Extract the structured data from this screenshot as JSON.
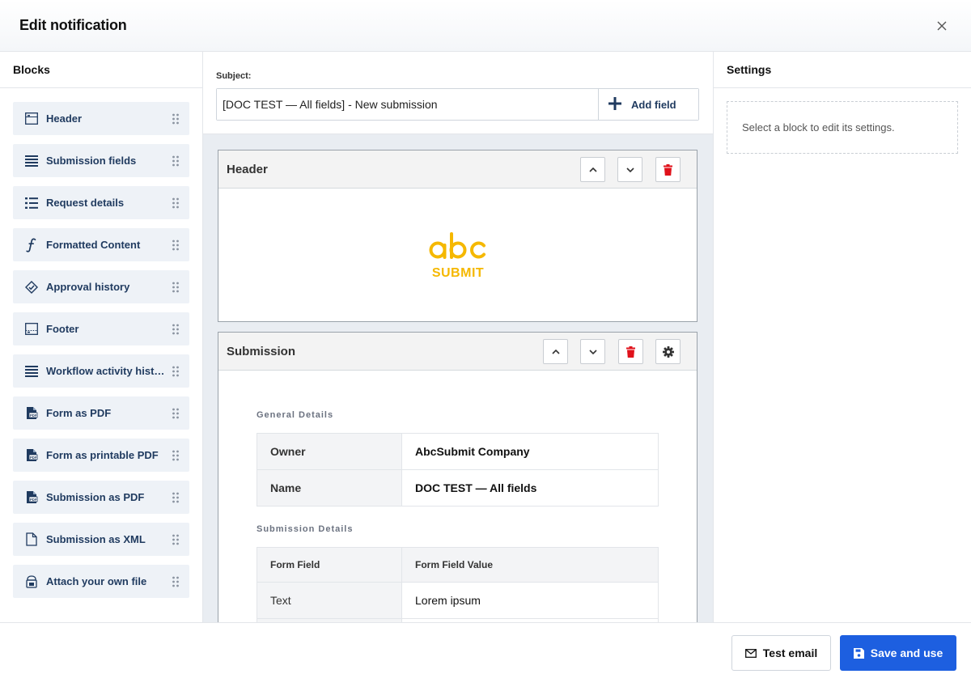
{
  "dialog": {
    "title": "Edit notification",
    "close_icon": "close-icon"
  },
  "blocks_panel": {
    "title": "Blocks",
    "items": [
      {
        "label": "Header",
        "icon": "header-icon"
      },
      {
        "label": "Submission fields",
        "icon": "list-lines-icon"
      },
      {
        "label": "Request details",
        "icon": "bullet-list-icon"
      },
      {
        "label": "Formatted Content",
        "icon": "function-icon"
      },
      {
        "label": "Approval history",
        "icon": "approval-icon"
      },
      {
        "label": "Footer",
        "icon": "footer-icon"
      },
      {
        "label": "Workflow activity history",
        "icon": "list-lines-icon"
      },
      {
        "label": "Form as PDF",
        "icon": "pdf-icon"
      },
      {
        "label": "Form as printable PDF",
        "icon": "pdf-icon"
      },
      {
        "label": "Submission as PDF",
        "icon": "pdf-icon"
      },
      {
        "label": "Submission as XML",
        "icon": "file-icon"
      },
      {
        "label": "Attach your own file",
        "icon": "attach-file-icon"
      }
    ]
  },
  "subject": {
    "label": "Subject:",
    "value": "[DOC TEST — All fields] - New submission",
    "add_field_label": "Add field"
  },
  "header_block": {
    "title": "Header",
    "logo_text_top": "abc",
    "logo_text_bottom": "SUBMIT",
    "brand_color": "#F5B800"
  },
  "submission_block": {
    "title": "Submission",
    "general_title": "General Details",
    "general_rows": [
      {
        "key": "Owner",
        "value": "AbcSubmit Company"
      },
      {
        "key": "Name",
        "value": "DOC TEST — All fields"
      }
    ],
    "details_title": "Submission Details",
    "fields_header": {
      "key": "Form Field",
      "value": "Form Field Value"
    },
    "field_rows": [
      {
        "key": "Text",
        "value": "Lorem ipsum"
      },
      {
        "key": "",
        "value": ""
      }
    ]
  },
  "settings_panel": {
    "title": "Settings",
    "empty_text": "Select a block to edit its settings."
  },
  "footer": {
    "test_email_label": "Test email",
    "save_label": "Save and use"
  },
  "colors": {
    "accent": "#1D5FE0",
    "delete": "#E0121B",
    "block_text": "#1F3A5F",
    "block_bg": "#EEF2F7"
  }
}
